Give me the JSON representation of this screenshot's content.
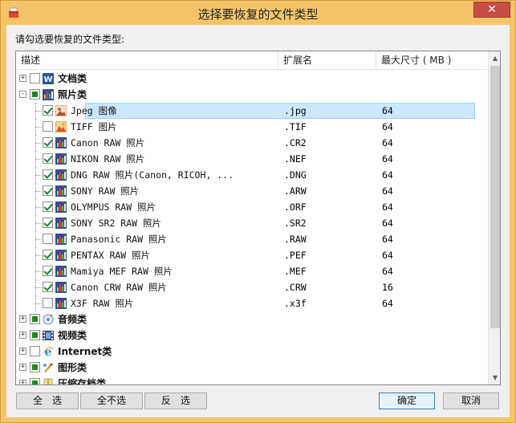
{
  "window": {
    "title": "选择要恢复的文件类型"
  },
  "prompt": "请勾选要恢复的文件类型:",
  "columns": {
    "desc": "描述",
    "ext": "扩展名",
    "size": "最大尺寸 ( MB )"
  },
  "rows": [
    {
      "label": "文档类",
      "level": 0,
      "expander": "+",
      "check": "none",
      "icon": "word-icon",
      "bold": true
    },
    {
      "label": "照片类",
      "level": 0,
      "expander": "-",
      "check": "partial",
      "icon": "photo-icon",
      "bold": true
    },
    {
      "label": "Jpeg 图像",
      "ext": ".jpg",
      "size": "64",
      "level": 1,
      "check": "checked",
      "icon": "jpeg-icon",
      "selected": true
    },
    {
      "label": "TIFF 图片",
      "ext": ".TIF",
      "size": "64",
      "level": 1,
      "check": "none",
      "icon": "tiff-icon"
    },
    {
      "label": "Canon RAW 照片",
      "ext": ".CR2",
      "size": "64",
      "level": 1,
      "check": "checked",
      "icon": "raw-icon"
    },
    {
      "label": "NIKON RAW 照片",
      "ext": ".NEF",
      "size": "64",
      "level": 1,
      "check": "checked",
      "icon": "raw-icon"
    },
    {
      "label": "DNG RAW 照片(Canon, RICOH, ...",
      "ext": ".DNG",
      "size": "64",
      "level": 1,
      "check": "checked",
      "icon": "raw-icon"
    },
    {
      "label": "SONY RAW 照片",
      "ext": ".ARW",
      "size": "64",
      "level": 1,
      "check": "checked",
      "icon": "raw-icon"
    },
    {
      "label": "OLYMPUS RAW 照片",
      "ext": ".ORF",
      "size": "64",
      "level": 1,
      "check": "checked",
      "icon": "raw-icon"
    },
    {
      "label": "SONY SR2 RAW 照片",
      "ext": ".SR2",
      "size": "64",
      "level": 1,
      "check": "checked",
      "icon": "raw-icon"
    },
    {
      "label": "Panasonic RAW 照片",
      "ext": ".RAW",
      "size": "64",
      "level": 1,
      "check": "none",
      "icon": "raw-icon"
    },
    {
      "label": "PENTAX RAW 照片",
      "ext": ".PEF",
      "size": "64",
      "level": 1,
      "check": "checked",
      "icon": "raw-icon"
    },
    {
      "label": "Mamiya MEF RAW 照片",
      "ext": ".MEF",
      "size": "64",
      "level": 1,
      "check": "checked",
      "icon": "raw-icon"
    },
    {
      "label": "Canon CRW RAW 照片",
      "ext": ".CRW",
      "size": "16",
      "level": 1,
      "check": "checked",
      "icon": "raw-icon"
    },
    {
      "label": "X3F RAW 照片",
      "ext": ".x3f",
      "size": "64",
      "level": 1,
      "check": "none",
      "icon": "raw-icon"
    },
    {
      "label": "音频类",
      "level": 0,
      "expander": "+",
      "check": "partial",
      "icon": "audio-icon",
      "bold": true
    },
    {
      "label": "视频类",
      "level": 0,
      "expander": "+",
      "check": "partial",
      "icon": "video-icon",
      "bold": true
    },
    {
      "label": "Internet类",
      "level": 0,
      "expander": "+",
      "check": "none",
      "icon": "ie-icon",
      "bold": true
    },
    {
      "label": "图形类",
      "level": 0,
      "expander": "+",
      "check": "partial",
      "icon": "graphics-icon",
      "bold": true
    },
    {
      "label": "压缩存档类",
      "level": 0,
      "expander": "+",
      "check": "partial",
      "icon": "archive-icon",
      "bold": true
    }
  ],
  "buttons": {
    "select_all": "全　选",
    "select_none": "全不选",
    "invert": "反　选",
    "ok": "确定",
    "cancel": "取消"
  },
  "close_glyph": "✕",
  "colors": {
    "titlebar": "#f5c46a",
    "close": "#c74e43",
    "selection": "#cce8ff",
    "check": "#2a7b2a"
  }
}
